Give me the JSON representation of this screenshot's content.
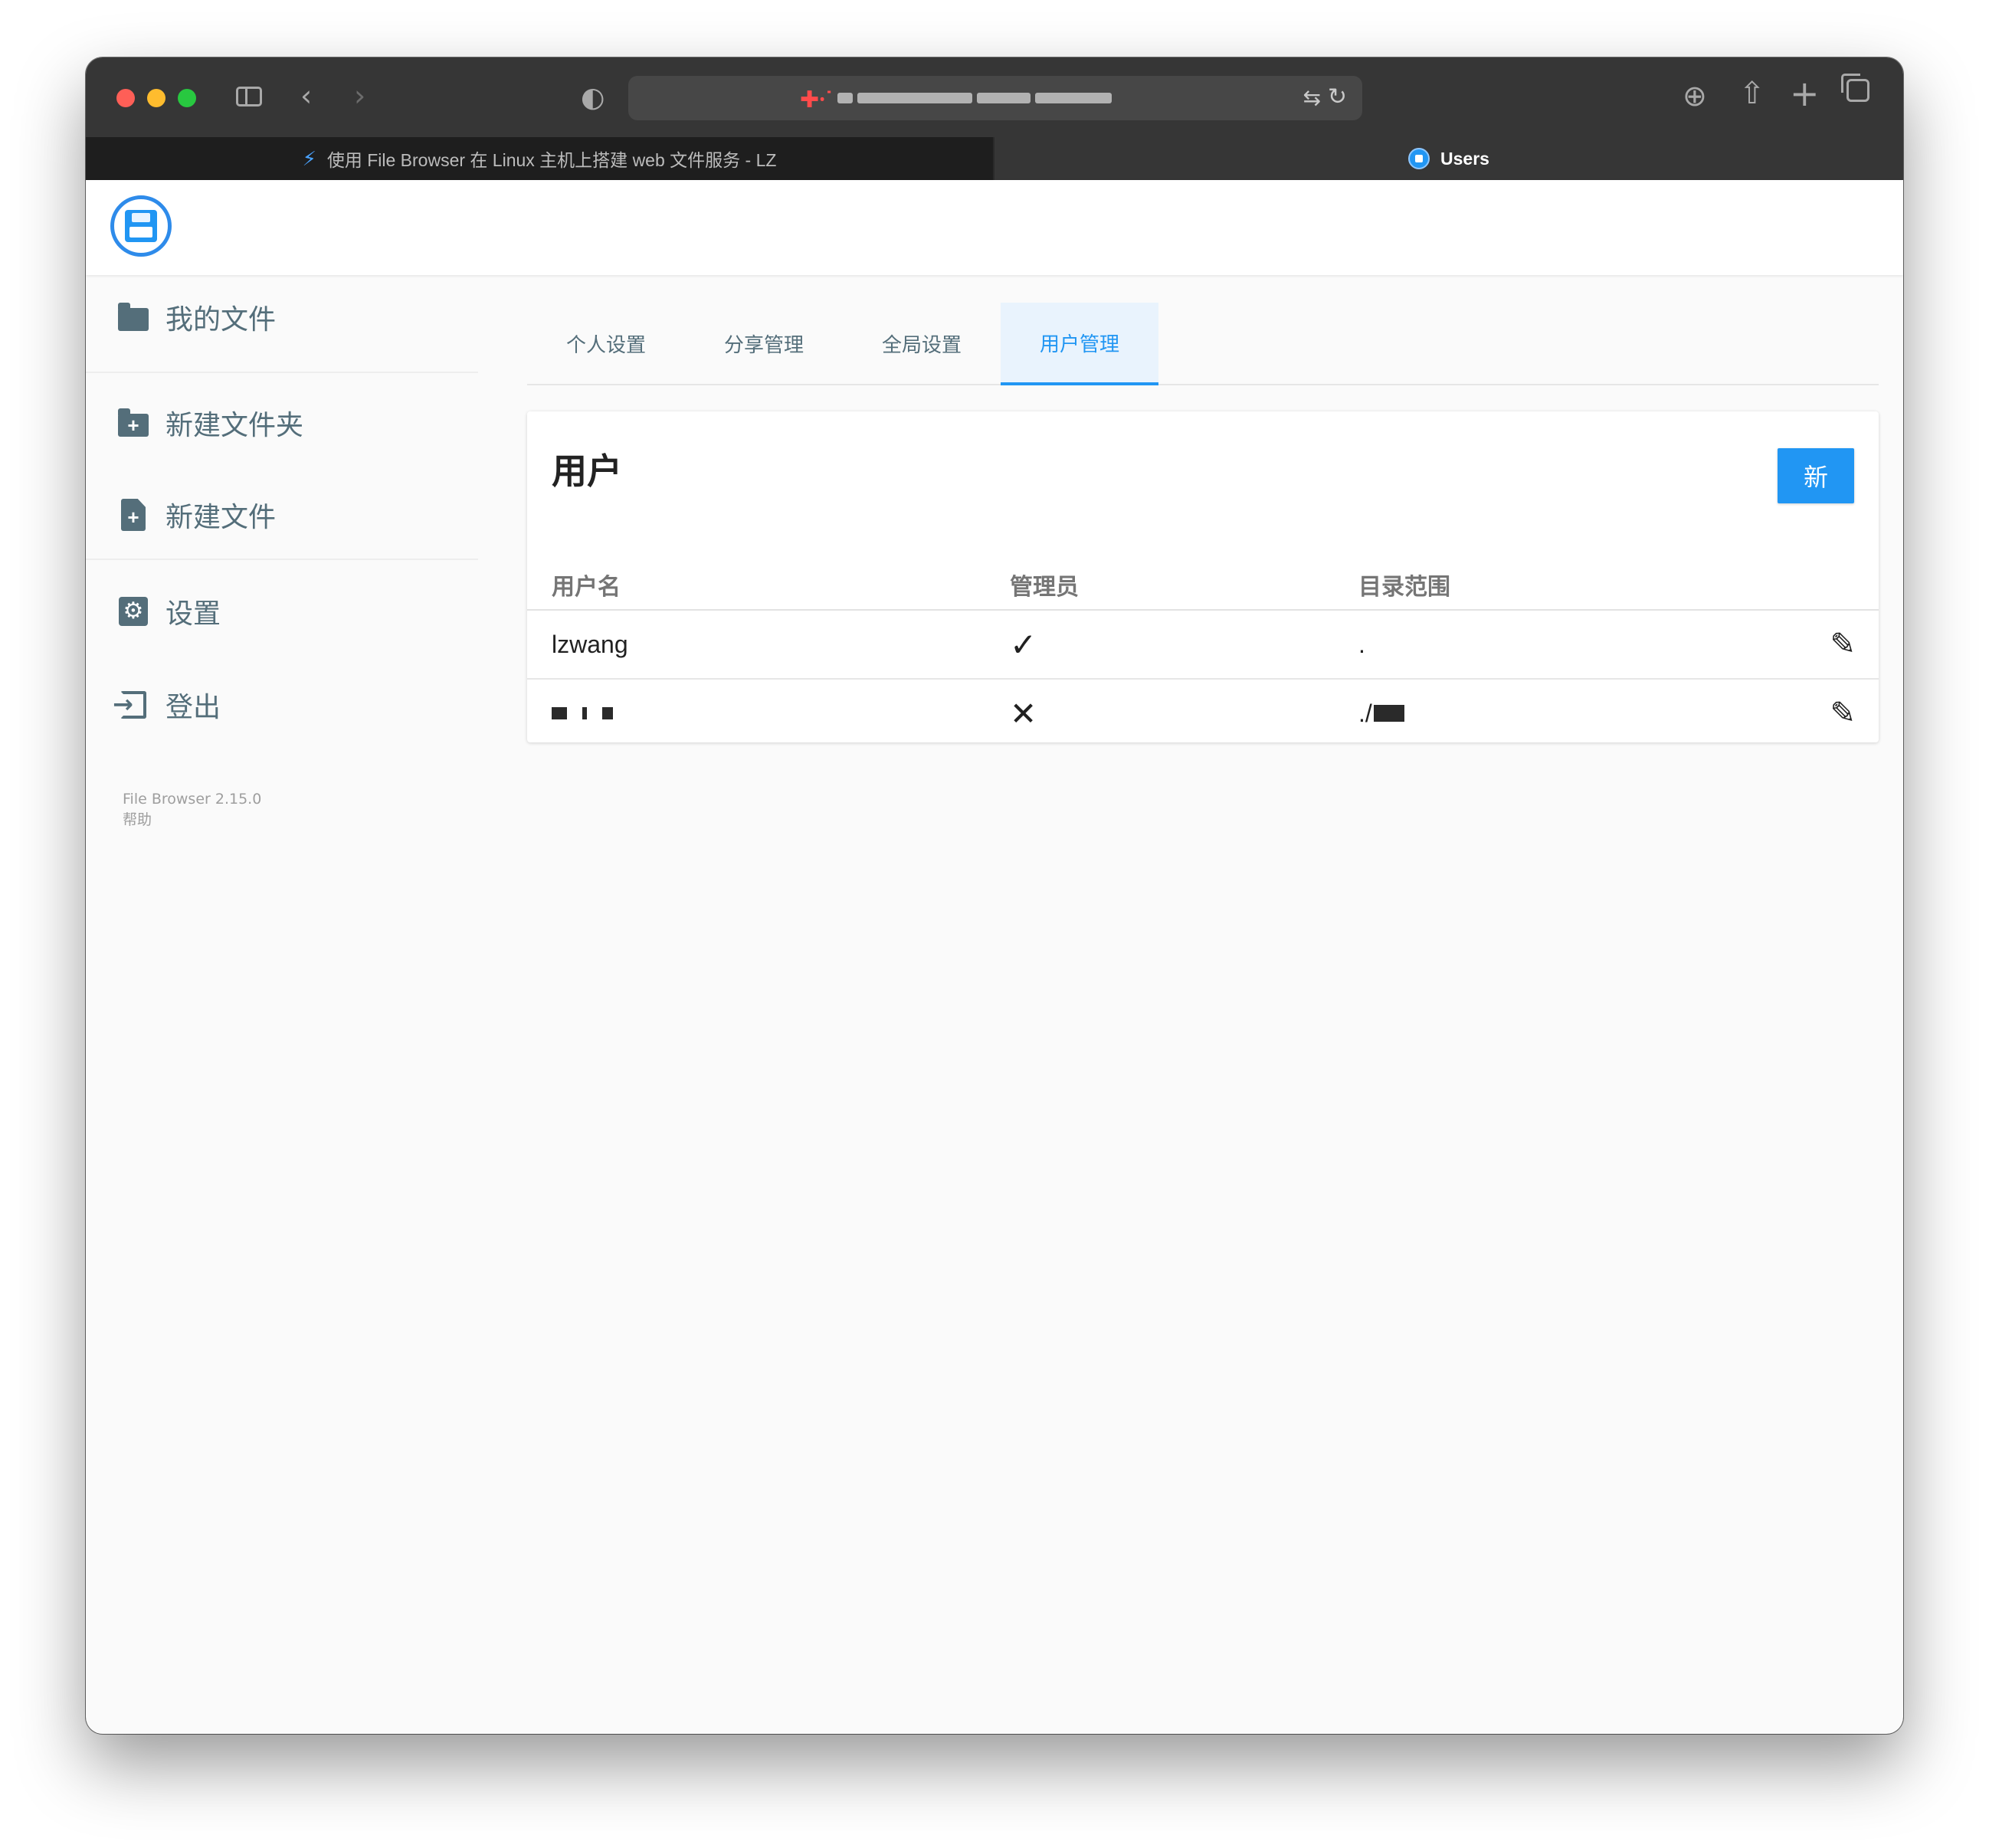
{
  "browser": {
    "url_prefix": "✚⸱˙",
    "tabs": [
      {
        "label": "使用 File Browser 在 Linux 主机上搭建 web 文件服务 - LZ",
        "icon": "bolt-icon",
        "active": false
      },
      {
        "label": "Users",
        "icon": "filebrowser-favicon",
        "active": true
      }
    ]
  },
  "sidebar": {
    "items": [
      {
        "label": "我的文件",
        "icon": "folder-icon"
      },
      {
        "label": "新建文件夹",
        "icon": "create-folder-icon"
      },
      {
        "label": "新建文件",
        "icon": "create-file-icon"
      },
      {
        "label": "设置",
        "icon": "settings-icon"
      },
      {
        "label": "登出",
        "icon": "logout-icon"
      }
    ],
    "credits": {
      "version": "File Browser 2.15.0",
      "help": "帮助"
    }
  },
  "settings_tabs": [
    {
      "label": "个人设置",
      "active": false
    },
    {
      "label": "分享管理",
      "active": false
    },
    {
      "label": "全局设置",
      "active": false
    },
    {
      "label": "用户管理",
      "active": true
    }
  ],
  "users_card": {
    "title": "用户",
    "new_button": "新",
    "columns": [
      "用户名",
      "管理员",
      "目录范围"
    ],
    "rows": [
      {
        "username": "lzwang",
        "admin": "✓",
        "scope": "."
      },
      {
        "username": "",
        "admin": "✕",
        "scope": "./"
      }
    ],
    "edit_icon": "✎"
  },
  "colors": {
    "accent": "#2196f3",
    "sidebar_text": "#546e7a",
    "chrome_dark": "#363636"
  }
}
